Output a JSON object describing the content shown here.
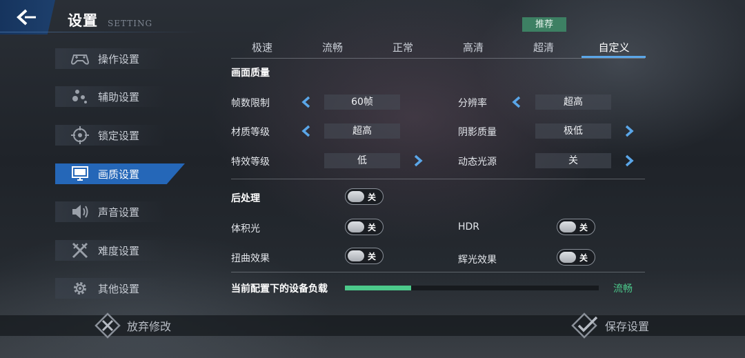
{
  "header": {
    "title": "设置",
    "subtitle": "SETTING"
  },
  "sidebar": {
    "items": [
      {
        "label": "操作设置",
        "icon": "gamepad-icon"
      },
      {
        "label": "辅助设置",
        "icon": "dots-icon"
      },
      {
        "label": "锁定设置",
        "icon": "crosshair-icon"
      },
      {
        "label": "画质设置",
        "icon": "monitor-icon",
        "active": true
      },
      {
        "label": "声音设置",
        "icon": "speaker-icon"
      },
      {
        "label": "难度设置",
        "icon": "crossed-swords-icon"
      },
      {
        "label": "其他设置",
        "icon": "gear-icon"
      }
    ]
  },
  "tabs": {
    "badge": "推荐",
    "items": [
      {
        "label": "极速"
      },
      {
        "label": "流畅"
      },
      {
        "label": "正常"
      },
      {
        "label": "高清"
      },
      {
        "label": "超清"
      },
      {
        "label": "自定义",
        "active": true
      }
    ]
  },
  "quality": {
    "section_title": "画面质量",
    "frame_limit": {
      "label": "帧数限制",
      "value": "60帧"
    },
    "resolution": {
      "label": "分辨率",
      "value": "超高"
    },
    "texture": {
      "label": "材质等级",
      "value": "超高"
    },
    "shadow": {
      "label": "阴影质量",
      "value": "极低"
    },
    "effects": {
      "label": "特效等级",
      "value": "低"
    },
    "dynamic_light": {
      "label": "动态光源",
      "value": "关"
    }
  },
  "post": {
    "label": "后处理",
    "state": "关",
    "volumetric": {
      "label": "体积光",
      "state": "关"
    },
    "hdr": {
      "label": "HDR",
      "state": "关"
    },
    "distortion": {
      "label": "扭曲效果",
      "state": "关"
    },
    "bloom": {
      "label": "辉光效果",
      "state": "关"
    }
  },
  "load": {
    "label": "当前配置下的设备负载",
    "status": "流畅",
    "fraction": 0.26
  },
  "footer": {
    "discard": "放弃修改",
    "save": "保存设置"
  },
  "colors": {
    "accent": "#2567b8",
    "arrow": "#5aa6e8",
    "good": "#4cc98b",
    "badge": "#3d8063"
  }
}
